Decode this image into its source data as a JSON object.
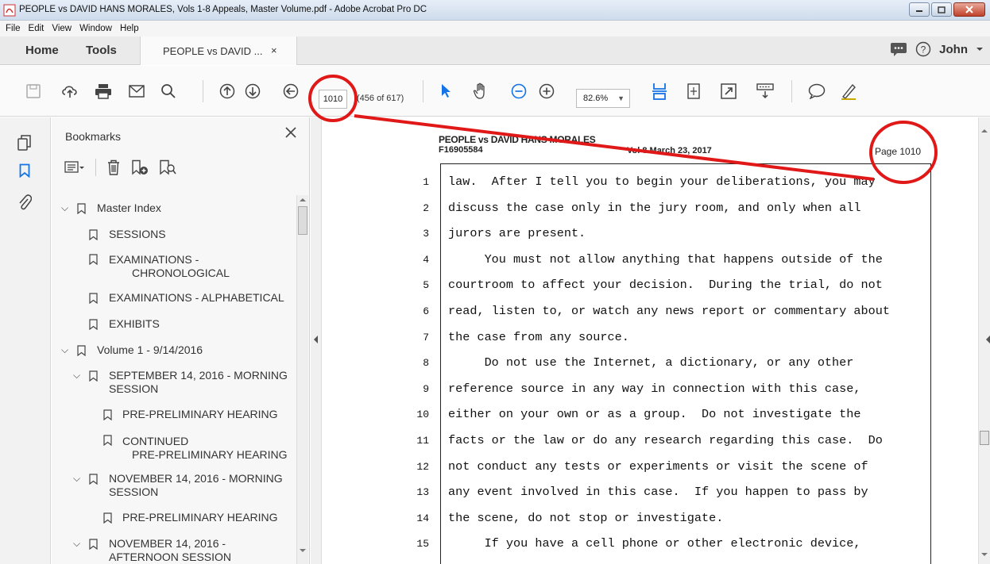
{
  "window": {
    "title": "PEOPLE vs DAVID HANS MORALES,  Vols 1-8 Appeals, Master Volume.pdf - Adobe Acrobat Pro DC"
  },
  "menu": [
    "File",
    "Edit",
    "View",
    "Window",
    "Help"
  ],
  "tabs": {
    "home": "Home",
    "tools": "Tools",
    "doc": "PEOPLE vs DAVID ...",
    "close": "×",
    "user": "John"
  },
  "toolbar": {
    "page_number": "1010",
    "page_count": "(456 of 617)",
    "zoom": "82.6%"
  },
  "bookmarks": {
    "title": "Bookmarks",
    "items": [
      {
        "label": "Master Index",
        "level": 0,
        "expanded": true
      },
      {
        "label": "SESSIONS",
        "level": 1
      },
      {
        "label": "EXAMINATIONS -",
        "label2": "CHRONOLOGICAL",
        "level": 1
      },
      {
        "label": "EXAMINATIONS - ALPHABETICAL",
        "level": 1
      },
      {
        "label": "EXHIBITS",
        "level": 1
      },
      {
        "label": "Volume 1 - 9/14/2016",
        "level": 0,
        "expanded": true
      },
      {
        "label": "SEPTEMBER 14, 2016 - MORNING",
        "label2": "SESSION",
        "level": 1,
        "expanded": true
      },
      {
        "label": "PRE-PRELIMINARY HEARING",
        "level": 2
      },
      {
        "label": "CONTINUED",
        "label2": "PRE-PRELIMINARY HEARING",
        "level": 2
      },
      {
        "label": "NOVEMBER 14, 2016 - MORNING",
        "label2": "SESSION",
        "level": 1,
        "expanded": true
      },
      {
        "label": "PRE-PRELIMINARY HEARING",
        "level": 2
      },
      {
        "label": "NOVEMBER 14, 2016 -",
        "label2": "AFTERNOON SESSION",
        "level": 1,
        "expanded": true
      }
    ]
  },
  "document": {
    "header_case": "PEOPLE vs DAVID HANS MORALES",
    "header_id": "F16905584",
    "header_vol": "Vol 8  March 23, 2017",
    "header_page": "Page 1010",
    "lines": [
      {
        "n": "1",
        "text": "law.  After I tell you to begin your deliberations, you may"
      },
      {
        "n": "2",
        "text": "discuss the case only in the jury room, and only when all"
      },
      {
        "n": "3",
        "text": "jurors are present."
      },
      {
        "n": "4",
        "text": "     You must not allow anything that happens outside of the"
      },
      {
        "n": "5",
        "text": "courtroom to affect your decision.  During the trial, do not"
      },
      {
        "n": "6",
        "text": "read, listen to, or watch any news report or commentary about"
      },
      {
        "n": "7",
        "text": "the case from any source."
      },
      {
        "n": "8",
        "text": "     Do not use the Internet, a dictionary, or any other"
      },
      {
        "n": "9",
        "text": "reference source in any way in connection with this case,"
      },
      {
        "n": "10",
        "text": "either on your own or as a group.  Do not investigate the"
      },
      {
        "n": "11",
        "text": "facts or the law or do any research regarding this case.  Do"
      },
      {
        "n": "12",
        "text": "not conduct any tests or experiments or visit the scene of"
      },
      {
        "n": "13",
        "text": "any event involved in this case.  If you happen to pass by"
      },
      {
        "n": "14",
        "text": "the scene, do not stop or investigate."
      },
      {
        "n": "15",
        "text": "     If you have a cell phone or other electronic device,"
      }
    ]
  },
  "colors": {
    "accent": "#1473e6",
    "annotation": "#e01818"
  }
}
